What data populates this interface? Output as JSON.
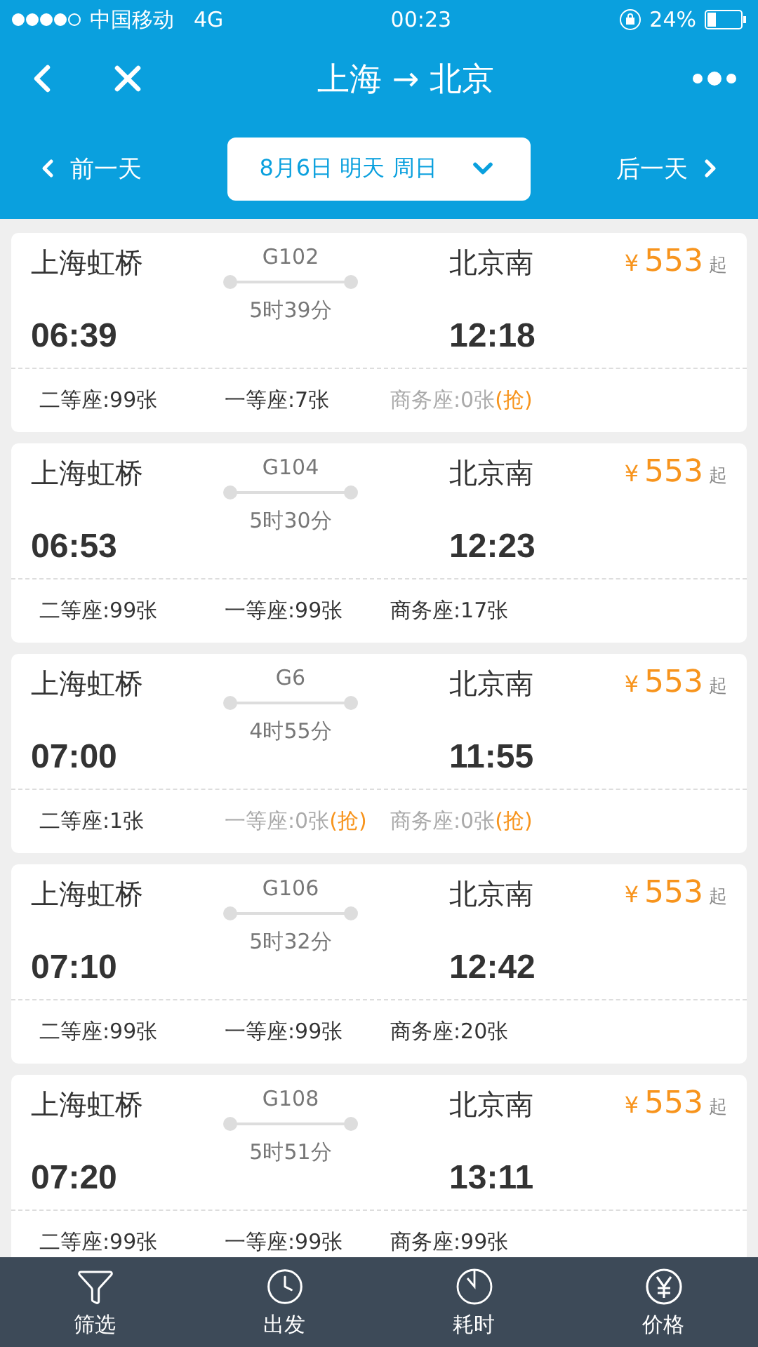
{
  "status_bar": {
    "carrier": "中国移动",
    "network": "4G",
    "time": "00:23",
    "battery": "24%"
  },
  "nav": {
    "title": "上海 → 北京"
  },
  "date_bar": {
    "prev": "前一天",
    "date": "8月6日 明天 周日",
    "next": "后一天"
  },
  "trains": [
    {
      "from": "上海虹桥",
      "depart": "06:39",
      "code": "G102",
      "duration": "5时39分",
      "to": "北京南",
      "arrive": "12:18",
      "currency": "¥",
      "price": "553",
      "price_suffix": "起",
      "seats": [
        {
          "text": "二等座:99张",
          "available": true
        },
        {
          "text": "一等座:7张",
          "available": true
        },
        {
          "text": "商务座:0张",
          "available": false,
          "grab": "(抢)"
        }
      ]
    },
    {
      "from": "上海虹桥",
      "depart": "06:53",
      "code": "G104",
      "duration": "5时30分",
      "to": "北京南",
      "arrive": "12:23",
      "currency": "¥",
      "price": "553",
      "price_suffix": "起",
      "seats": [
        {
          "text": "二等座:99张",
          "available": true
        },
        {
          "text": "一等座:99张",
          "available": true
        },
        {
          "text": "商务座:17张",
          "available": true
        }
      ]
    },
    {
      "from": "上海虹桥",
      "depart": "07:00",
      "code": "G6",
      "duration": "4时55分",
      "to": "北京南",
      "arrive": "11:55",
      "currency": "¥",
      "price": "553",
      "price_suffix": "起",
      "seats": [
        {
          "text": "二等座:1张",
          "available": true
        },
        {
          "text": "一等座:0张",
          "available": false,
          "grab": "(抢)"
        },
        {
          "text": "商务座:0张",
          "available": false,
          "grab": "(抢)"
        }
      ]
    },
    {
      "from": "上海虹桥",
      "depart": "07:10",
      "code": "G106",
      "duration": "5时32分",
      "to": "北京南",
      "arrive": "12:42",
      "currency": "¥",
      "price": "553",
      "price_suffix": "起",
      "seats": [
        {
          "text": "二等座:99张",
          "available": true
        },
        {
          "text": "一等座:99张",
          "available": true
        },
        {
          "text": "商务座:20张",
          "available": true
        }
      ]
    },
    {
      "from": "上海虹桥",
      "depart": "07:20",
      "code": "G108",
      "duration": "5时51分",
      "to": "北京南",
      "arrive": "13:11",
      "currency": "¥",
      "price": "553",
      "price_suffix": "起",
      "seats": [
        {
          "text": "二等座:99张",
          "available": true
        },
        {
          "text": "一等座:99张",
          "available": true
        },
        {
          "text": "商务座:99张",
          "available": true
        }
      ]
    }
  ],
  "tab_bar": [
    {
      "kind": "filter",
      "label": "筛选"
    },
    {
      "kind": "depart",
      "label": "出发"
    },
    {
      "kind": "duration",
      "label": "耗时"
    },
    {
      "kind": "price",
      "label": "价格"
    }
  ]
}
